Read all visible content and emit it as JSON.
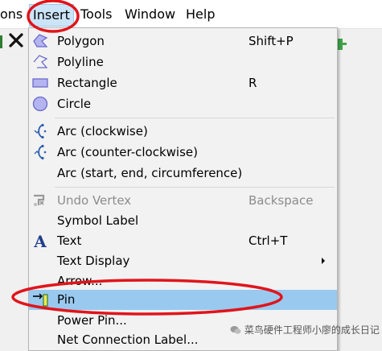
{
  "menubar": {
    "items": [
      {
        "label": "ons"
      },
      {
        "label": "Insert"
      },
      {
        "label": "Tools"
      },
      {
        "label": "Window"
      },
      {
        "label": "Help"
      }
    ]
  },
  "menu": {
    "items": [
      {
        "label": "Polygon",
        "shortcut": "Shift+P",
        "icon": "polygon-icon"
      },
      {
        "label": "Polyline",
        "shortcut": "",
        "icon": "polyline-icon"
      },
      {
        "label": "Rectangle",
        "shortcut": "R",
        "icon": "rectangle-icon"
      },
      {
        "label": "Circle",
        "shortcut": "",
        "icon": "circle-icon"
      },
      {
        "label": "Arc (clockwise)",
        "shortcut": "",
        "icon": "arc-clockwise-icon"
      },
      {
        "label": "Arc (counter-clockwise)",
        "shortcut": "",
        "icon": "arc-counter-clockwise-icon"
      },
      {
        "label": "Arc (start, end, circumference)",
        "shortcut": ""
      },
      {
        "label": "Undo Vertex",
        "shortcut": "Backspace",
        "icon": "undo-vertex-icon",
        "disabled": true
      },
      {
        "label": "Symbol Label",
        "shortcut": ""
      },
      {
        "label": "Text",
        "shortcut": "Ctrl+T",
        "icon": "text-icon"
      },
      {
        "label": "Text Display",
        "shortcut": "",
        "has_submenu": true
      },
      {
        "label": "Arrow...",
        "shortcut": ""
      },
      {
        "label": "Pin",
        "shortcut": "",
        "icon": "pin-icon",
        "highlighted": true
      },
      {
        "label": "Power Pin...",
        "shortcut": ""
      },
      {
        "label": "Net Connection Label...",
        "shortcut": ""
      }
    ]
  },
  "watermark": {
    "text": "菜鸟硬件工程师小廖的成长日记"
  },
  "colors": {
    "highlight": "#99c9ef",
    "annotation_red": "#e0151b",
    "icon_purple_fill": "#b4b4f0",
    "icon_purple_stroke": "#6a6acd"
  }
}
